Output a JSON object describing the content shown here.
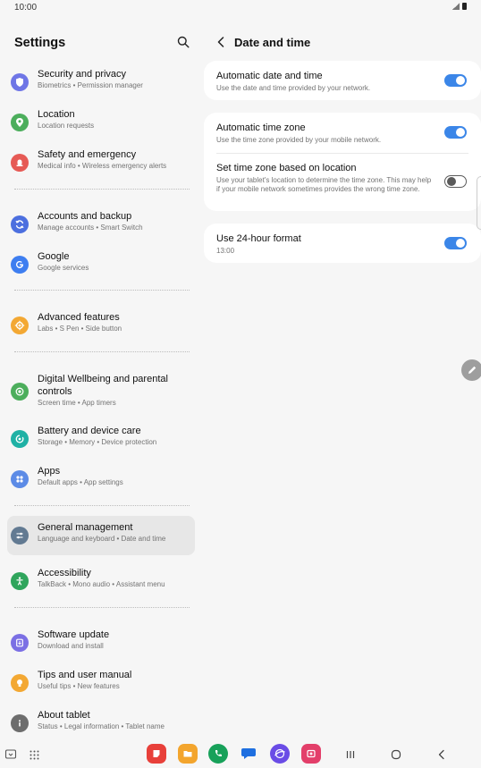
{
  "status": {
    "time": "10:00"
  },
  "colors": {
    "accent": "#3b86e8",
    "toggle_off": "#5a5a5a"
  },
  "left": {
    "title": "Settings",
    "search_icon": "search-icon",
    "items": [
      {
        "title": "Security and privacy",
        "sub": "Biometrics  •  Permission manager",
        "icon": "shield-icon",
        "color": "#6f76e6"
      },
      {
        "title": "Location",
        "sub": "Location requests",
        "icon": "location-pin-icon",
        "color": "#4cae5c"
      },
      {
        "title": "Safety and emergency",
        "sub": "Medical info  •  Wireless emergency alerts",
        "icon": "alert-icon",
        "color": "#e65a55"
      },
      {
        "title": "Accounts and backup",
        "sub": "Manage accounts  •  Smart Switch",
        "icon": "sync-icon",
        "color": "#4c6fdf"
      },
      {
        "title": "Google",
        "sub": "Google services",
        "icon": "google-icon",
        "color": "#3e7ef0"
      },
      {
        "title": "Advanced features",
        "sub": "Labs  •  S Pen  •  Side button",
        "icon": "gear-plus-icon",
        "color": "#f3a833"
      },
      {
        "title": "Digital Wellbeing and parental controls",
        "sub": "Screen time  •  App timers",
        "icon": "wellbeing-icon",
        "color": "#4cae5c"
      },
      {
        "title": "Battery and device care",
        "sub": "Storage  •  Memory  •  Device protection",
        "icon": "device-care-icon",
        "color": "#1fb1a5"
      },
      {
        "title": "Apps",
        "sub": "Default apps  •  App settings",
        "icon": "apps-grid-icon",
        "color": "#5c8be6"
      },
      {
        "title": "General management",
        "sub": "Language and keyboard  •  Date and time",
        "icon": "sliders-icon",
        "color": "#627a92"
      },
      {
        "title": "Accessibility",
        "sub": "TalkBack  •  Mono audio  •  Assistant menu",
        "icon": "accessibility-icon",
        "color": "#2fa55c"
      },
      {
        "title": "Software update",
        "sub": "Download and install",
        "icon": "update-icon",
        "color": "#7b6fe4"
      },
      {
        "title": "Tips and user manual",
        "sub": "Useful tips  •  New features",
        "icon": "lightbulb-icon",
        "color": "#f3a833"
      },
      {
        "title": "About tablet",
        "sub": "Status  •  Legal information  •  Tablet name",
        "icon": "info-icon",
        "color": "#6d6d6d"
      }
    ]
  },
  "right": {
    "title": "Date and time",
    "back_icon": "chevron-left-icon",
    "auto_date": {
      "title": "Automatic date and time",
      "sub": "Use the date and time provided by your network.",
      "on": true
    },
    "auto_zone": {
      "title": "Automatic time zone",
      "sub": "Use the time zone provided by your mobile network.",
      "on": true
    },
    "location_zone": {
      "title": "Set time zone based on location",
      "sub": "Use your tablet's location to determine the time zone. This may help if your mobile network sometimes provides the wrong time zone.",
      "on": false
    },
    "format24": {
      "title": "Use 24-hour format",
      "sub": "13:00",
      "on": true
    }
  },
  "nav": {
    "apps": [
      {
        "icon": "notes-app-icon",
        "color": "#e8403a"
      },
      {
        "icon": "folder-app-icon",
        "color": "#f3a52d"
      },
      {
        "icon": "phone-app-icon",
        "color": "#18a15a"
      },
      {
        "icon": "messages-app-icon",
        "color": "#1e6fe0"
      },
      {
        "icon": "internet-app-icon",
        "color": "#6a4ce6"
      },
      {
        "icon": "screen-recorder-app-icon",
        "color": "#e33f6a"
      }
    ]
  }
}
